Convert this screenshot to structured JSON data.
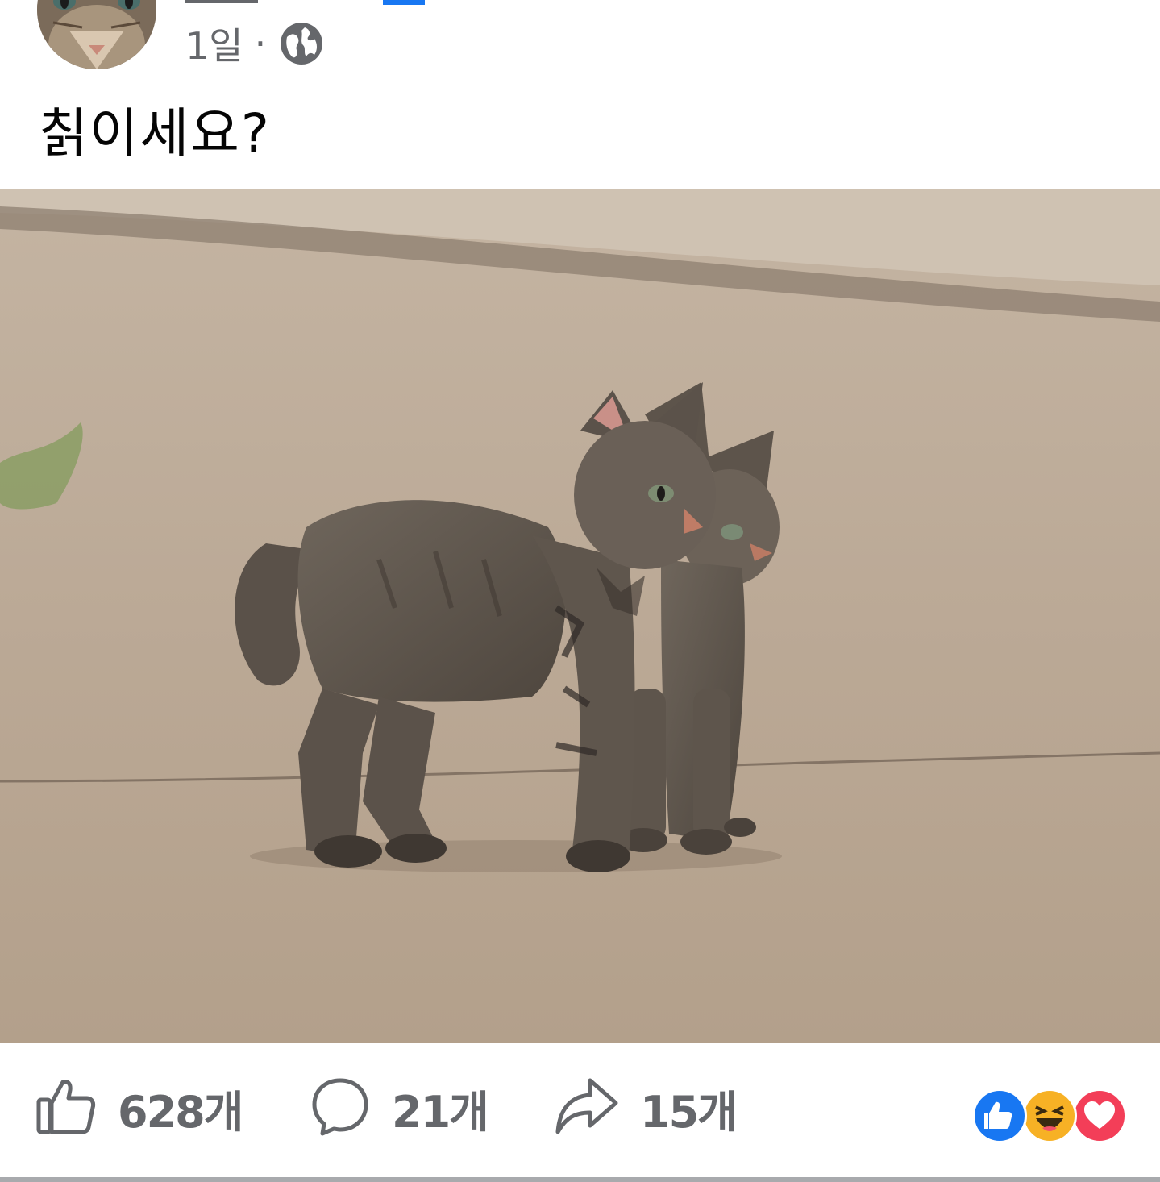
{
  "post": {
    "time": "1일",
    "separator": "·",
    "privacy_icon": "globe-icon",
    "text": "칡이세요?"
  },
  "photo": {
    "subject": "two-tabby-kittens-on-pavement"
  },
  "actions": {
    "like": {
      "icon": "thumbs-up-icon",
      "count": "628개"
    },
    "comment": {
      "icon": "comment-bubble-icon",
      "count": "21개"
    },
    "share": {
      "icon": "share-arrow-icon",
      "count": "15개"
    }
  },
  "reactions": [
    {
      "icon": "like-reaction-icon",
      "color": "#1877f2"
    },
    {
      "icon": "haha-reaction-icon",
      "color": "#f7b125"
    },
    {
      "icon": "love-reaction-icon",
      "color": "#f33e58"
    }
  ],
  "colors": {
    "meta_text": "#65676b",
    "body_text": "#050505",
    "brand_blue": "#1877f2"
  }
}
